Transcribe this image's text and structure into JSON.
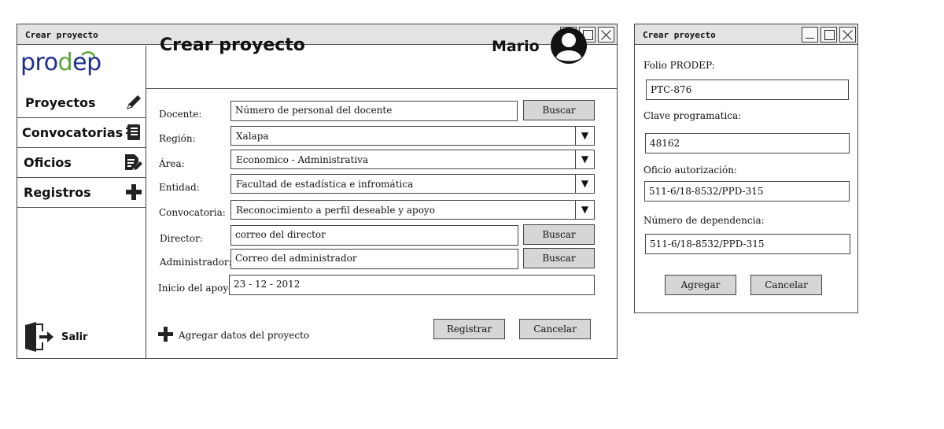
{
  "main_window": {
    "title": "Crear proyecto",
    "page_title": "Crear proyecto",
    "user_name": "Mario",
    "logo_text": "prodep",
    "sidebar": {
      "items": [
        {
          "label": "Proyectos",
          "icon": "pencil-icon"
        },
        {
          "label": "Convocatorias",
          "icon": "notebook-icon"
        },
        {
          "label": "Oficios",
          "icon": "document-edit-icon"
        },
        {
          "label": "Registros",
          "icon": "plus-icon"
        }
      ],
      "exit_label": "Salir"
    },
    "form": {
      "docente": {
        "label": "Docente:",
        "placeholder": "Número de personal del docente",
        "button": "Buscar"
      },
      "region": {
        "label": "Región:",
        "value": "Xalapa"
      },
      "area": {
        "label": "Área:",
        "value": "Economico - Administrativa"
      },
      "entidad": {
        "label": "Entidad:",
        "value": "Facultad de estadística e infromática"
      },
      "convocatoria": {
        "label": "Convocatoria:",
        "value": "Reconocimiento a perfil deseable y apoyo"
      },
      "director": {
        "label": "Director:",
        "placeholder": "correo del director",
        "button": "Buscar"
      },
      "administrador": {
        "label": "Administrador:",
        "placeholder": "Correo del administrador",
        "button": "Buscar"
      },
      "inicio": {
        "label": "Inicio del apoyo:",
        "value": "23 - 12 - 2012"
      },
      "add_data_label": "Agregar datos del proyecto",
      "register_button": "Registrar",
      "cancel_button": "Cancelar"
    }
  },
  "dialog": {
    "title": "Crear proyecto",
    "folio": {
      "label": "Folio PRODEP:",
      "value": "PTC-876"
    },
    "clave": {
      "label": "Clave programatica:",
      "value": "48162"
    },
    "oficio": {
      "label": "Oficio autorización:",
      "value": "511-6/18-8532/PPD-315"
    },
    "dependencia": {
      "label": "Número de dependencia:",
      "value": "511-6/18-8532/PPD-315"
    },
    "add_button": "Agregar",
    "cancel_button": "Cancelar"
  },
  "colors": {
    "logo_primary": "#1c2f8c",
    "logo_accent": "#5aa63a",
    "button_fill": "#d6d6d6",
    "titlebar": "#e3e3e3"
  }
}
